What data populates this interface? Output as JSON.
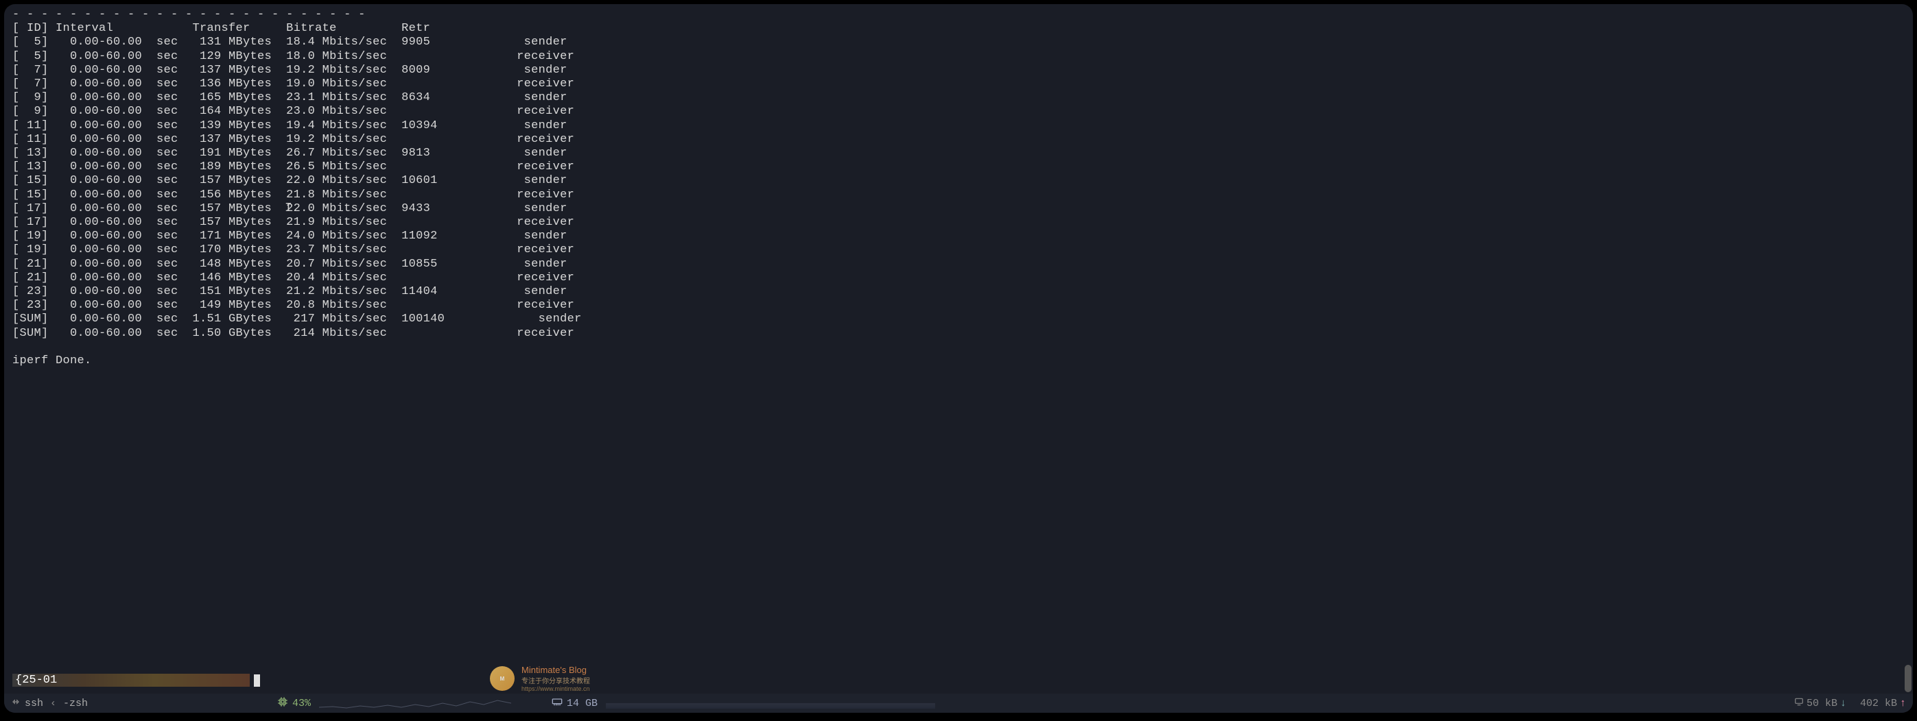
{
  "terminal": {
    "dashes": "- - - - - - - - - - - - - - - - - - - - - - - - -",
    "header": "[ ID] Interval           Transfer     Bitrate         Retr",
    "rows": [
      {
        "id": "[  5]",
        "interval": "0.00-60.00",
        "unit": "sec",
        "transfer": "131 MBytes",
        "bitrate": "18.4 Mbits/sec",
        "retr": "9905",
        "role": "sender"
      },
      {
        "id": "[  5]",
        "interval": "0.00-60.00",
        "unit": "sec",
        "transfer": "129 MBytes",
        "bitrate": "18.0 Mbits/sec",
        "retr": "",
        "role": "receiver"
      },
      {
        "id": "[  7]",
        "interval": "0.00-60.00",
        "unit": "sec",
        "transfer": "137 MBytes",
        "bitrate": "19.2 Mbits/sec",
        "retr": "8009",
        "role": "sender"
      },
      {
        "id": "[  7]",
        "interval": "0.00-60.00",
        "unit": "sec",
        "transfer": "136 MBytes",
        "bitrate": "19.0 Mbits/sec",
        "retr": "",
        "role": "receiver"
      },
      {
        "id": "[  9]",
        "interval": "0.00-60.00",
        "unit": "sec",
        "transfer": "165 MBytes",
        "bitrate": "23.1 Mbits/sec",
        "retr": "8634",
        "role": "sender"
      },
      {
        "id": "[  9]",
        "interval": "0.00-60.00",
        "unit": "sec",
        "transfer": "164 MBytes",
        "bitrate": "23.0 Mbits/sec",
        "retr": "",
        "role": "receiver"
      },
      {
        "id": "[ 11]",
        "interval": "0.00-60.00",
        "unit": "sec",
        "transfer": "139 MBytes",
        "bitrate": "19.4 Mbits/sec",
        "retr": "10394",
        "role": "sender"
      },
      {
        "id": "[ 11]",
        "interval": "0.00-60.00",
        "unit": "sec",
        "transfer": "137 MBytes",
        "bitrate": "19.2 Mbits/sec",
        "retr": "",
        "role": "receiver"
      },
      {
        "id": "[ 13]",
        "interval": "0.00-60.00",
        "unit": "sec",
        "transfer": "191 MBytes",
        "bitrate": "26.7 Mbits/sec",
        "retr": "9813",
        "role": "sender"
      },
      {
        "id": "[ 13]",
        "interval": "0.00-60.00",
        "unit": "sec",
        "transfer": "189 MBytes",
        "bitrate": "26.5 Mbits/sec",
        "retr": "",
        "role": "receiver"
      },
      {
        "id": "[ 15]",
        "interval": "0.00-60.00",
        "unit": "sec",
        "transfer": "157 MBytes",
        "bitrate": "22.0 Mbits/sec",
        "retr": "10601",
        "role": "sender"
      },
      {
        "id": "[ 15]",
        "interval": "0.00-60.00",
        "unit": "sec",
        "transfer": "156 MBytes",
        "bitrate": "21.8 Mbits/sec",
        "retr": "",
        "role": "receiver"
      },
      {
        "id": "[ 17]",
        "interval": "0.00-60.00",
        "unit": "sec",
        "transfer": "157 MBytes",
        "bitrate": "22.0 Mbits/sec",
        "retr": "9433",
        "role": "sender"
      },
      {
        "id": "[ 17]",
        "interval": "0.00-60.00",
        "unit": "sec",
        "transfer": "157 MBytes",
        "bitrate": "21.9 Mbits/sec",
        "retr": "",
        "role": "receiver"
      },
      {
        "id": "[ 19]",
        "interval": "0.00-60.00",
        "unit": "sec",
        "transfer": "171 MBytes",
        "bitrate": "24.0 Mbits/sec",
        "retr": "11092",
        "role": "sender"
      },
      {
        "id": "[ 19]",
        "interval": "0.00-60.00",
        "unit": "sec",
        "transfer": "170 MBytes",
        "bitrate": "23.7 Mbits/sec",
        "retr": "",
        "role": "receiver"
      },
      {
        "id": "[ 21]",
        "interval": "0.00-60.00",
        "unit": "sec",
        "transfer": "148 MBytes",
        "bitrate": "20.7 Mbits/sec",
        "retr": "10855",
        "role": "sender"
      },
      {
        "id": "[ 21]",
        "interval": "0.00-60.00",
        "unit": "sec",
        "transfer": "146 MBytes",
        "bitrate": "20.4 Mbits/sec",
        "retr": "",
        "role": "receiver"
      },
      {
        "id": "[ 23]",
        "interval": "0.00-60.00",
        "unit": "sec",
        "transfer": "151 MBytes",
        "bitrate": "21.2 Mbits/sec",
        "retr": "11404",
        "role": "sender"
      },
      {
        "id": "[ 23]",
        "interval": "0.00-60.00",
        "unit": "sec",
        "transfer": "149 MBytes",
        "bitrate": "20.8 Mbits/sec",
        "retr": "",
        "role": "receiver"
      },
      {
        "id": "[SUM]",
        "interval": "0.00-60.00",
        "unit": "sec",
        "transfer": "1.51 GBytes",
        "bitrate": "217 Mbits/sec",
        "retr": "100140",
        "role": "sender"
      },
      {
        "id": "[SUM]",
        "interval": "0.00-60.00",
        "unit": "sec",
        "transfer": "1.50 GBytes",
        "bitrate": "214 Mbits/sec",
        "retr": "",
        "role": "receiver"
      }
    ],
    "done": "iperf Done.",
    "prompt": "{25-01"
  },
  "statusbar": {
    "ssh": "ssh",
    "separator": "‹",
    "shell": "-zsh",
    "cpu_pct": "43%",
    "mem": "14 GB",
    "net_down": "50 kB",
    "net_up": "402 kB"
  },
  "watermark": {
    "title": "Mintimate's Blog",
    "subtitle": "专注于你分享技术教程",
    "url": "https://www.mintimate.cn"
  }
}
